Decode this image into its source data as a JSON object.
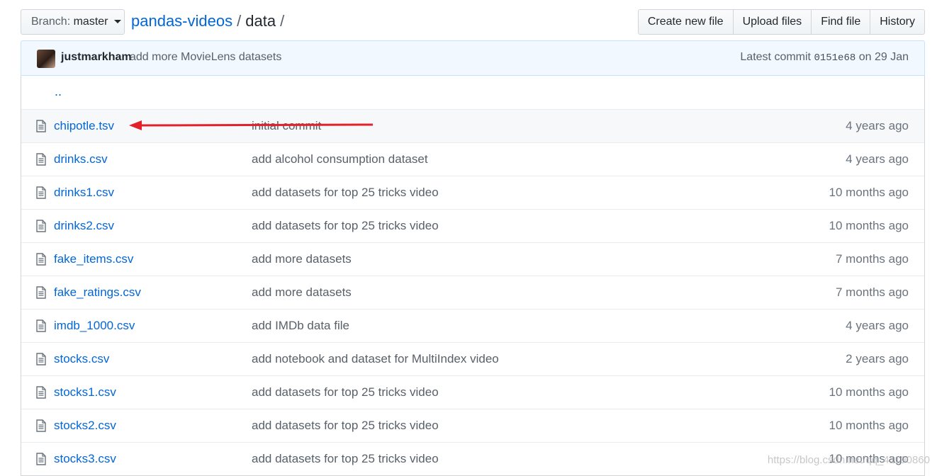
{
  "toolbar": {
    "branch_label": "Branch:",
    "branch_value": "master",
    "repo": "pandas-videos",
    "separator": "/",
    "current_dir": "data",
    "trailing_sep": "/",
    "buttons": [
      "Create new file",
      "Upload files",
      "Find file",
      "History"
    ]
  },
  "commit": {
    "user": "justmarkham",
    "message": "add more MovieLens datasets",
    "latest_label": "Latest commit",
    "sha": "0151e68",
    "date": "on 29 Jan"
  },
  "parent_link": "..",
  "files": [
    {
      "name": "chipotle.tsv",
      "message": "initial commit",
      "age": "4 years ago"
    },
    {
      "name": "drinks.csv",
      "message": "add alcohol consumption dataset",
      "age": "4 years ago"
    },
    {
      "name": "drinks1.csv",
      "message": "add datasets for top 25 tricks video",
      "age": "10 months ago"
    },
    {
      "name": "drinks2.csv",
      "message": "add datasets for top 25 tricks video",
      "age": "10 months ago"
    },
    {
      "name": "fake_items.csv",
      "message": "add more datasets",
      "age": "7 months ago"
    },
    {
      "name": "fake_ratings.csv",
      "message": "add more datasets",
      "age": "7 months ago"
    },
    {
      "name": "imdb_1000.csv",
      "message": "add IMDb data file",
      "age": "4 years ago"
    },
    {
      "name": "stocks.csv",
      "message": "add notebook and dataset for MultiIndex video",
      "age": "2 years ago"
    },
    {
      "name": "stocks1.csv",
      "message": "add datasets for top 25 tricks video",
      "age": "10 months ago"
    },
    {
      "name": "stocks2.csv",
      "message": "add datasets for top 25 tricks video",
      "age": "10 months ago"
    },
    {
      "name": "stocks3.csv",
      "message": "add datasets for top 25 tricks video",
      "age": "10 months ago"
    }
  ],
  "watermark": "https://blog.csdn.net/qq_41190860",
  "colors": {
    "link": "#0366d6",
    "arrow": "#e3212b",
    "commit_bg": "#f1f8ff"
  }
}
